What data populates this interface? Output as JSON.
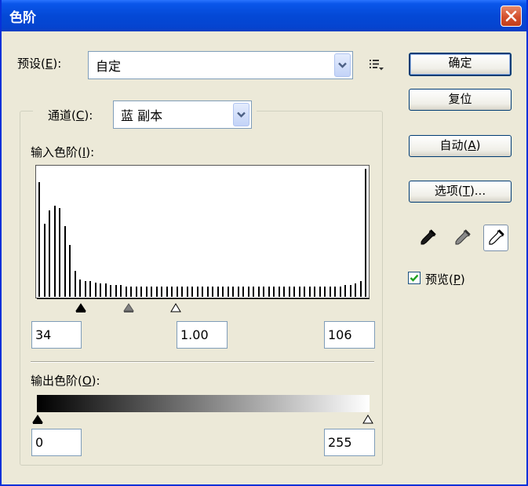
{
  "window": {
    "title": "色阶"
  },
  "preset": {
    "label": "预设(",
    "mnemonic": "E",
    "suffix": "):",
    "value": "自定"
  },
  "channel": {
    "label": "通道(",
    "mnemonic": "C",
    "suffix": "):",
    "value": "蓝 副本"
  },
  "input_levels": {
    "label": "输入色阶(",
    "mnemonic": "I",
    "suffix": "):",
    "black": "34",
    "gamma": "1.00",
    "white": "106"
  },
  "output_levels": {
    "label": "输出色阶(",
    "mnemonic": "O",
    "suffix": "):",
    "black": "0",
    "white": "255"
  },
  "buttons": {
    "ok": "确定",
    "reset": "复位",
    "auto": {
      "label": "自动(",
      "mnemonic": "A",
      "suffix": ")"
    },
    "options": {
      "label": "选项(",
      "mnemonic": "T",
      "suffix": ")..."
    }
  },
  "preview": {
    "label": "预览(",
    "mnemonic": "P",
    "suffix": ")",
    "checked": true
  },
  "icons": {
    "close": "close-icon",
    "preset_menu": "list-menu-icon",
    "dropdown": "chevron-down-icon",
    "black_eyedropper": "eyedropper-black-icon",
    "gray_eyedropper": "eyedropper-gray-icon",
    "white_eyedropper": "eyedropper-white-icon"
  },
  "colors": {
    "titlebar": "#0449d6",
    "close": "#d4502c",
    "face": "#ece9d8",
    "check": "#21a121"
  },
  "histogram_levels": [
    0.88,
    0.56,
    0.66,
    0.7,
    0.68,
    0.54,
    0.4,
    0.2,
    0.13,
    0.12,
    0.12,
    0.11,
    0.1,
    0.1,
    0.09,
    0.09,
    0.09,
    0.08,
    0.08,
    0.08,
    0.08,
    0.08,
    0.08,
    0.08,
    0.08,
    0.08,
    0.08,
    0.08,
    0.08,
    0.08,
    0.08,
    0.08,
    0.08,
    0.08,
    0.08,
    0.08,
    0.08,
    0.08,
    0.08,
    0.08,
    0.08,
    0.08,
    0.08,
    0.08,
    0.08,
    0.08,
    0.08,
    0.08,
    0.08,
    0.08,
    0.08,
    0.08,
    0.08,
    0.08,
    0.08,
    0.08,
    0.08,
    0.08,
    0.08,
    0.08,
    0.09,
    0.09,
    0.1,
    0.12,
    0.98
  ]
}
